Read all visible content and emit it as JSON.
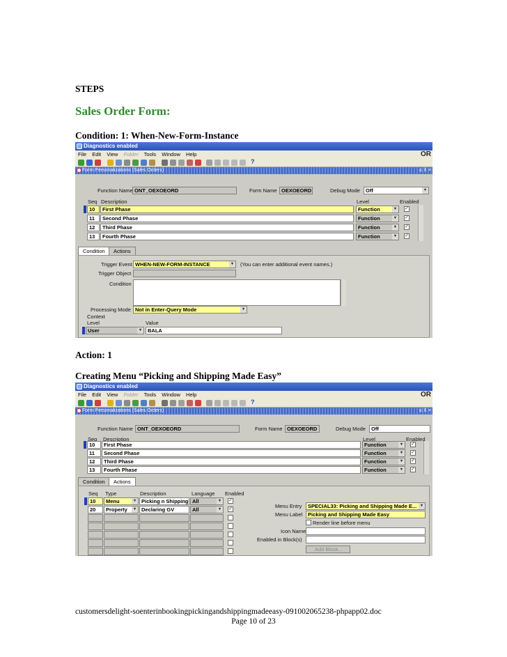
{
  "headings": {
    "steps": "STEPS",
    "sales_order_form": "Sales Order Form:",
    "condition": "Condition: 1: When-New-Form-Instance",
    "action": "Action: 1",
    "creating_menu": "Creating Menu “Picking and Shipping Made Easy”"
  },
  "app": {
    "titlebar": "Diagnostics enabled",
    "menu": [
      "File",
      "Edit",
      "View",
      "Folder",
      "Tools",
      "Window",
      "Help"
    ],
    "logo": "OR",
    "form_window_title": "Form Personalizations (Sales Orders)"
  },
  "form": {
    "function_name_label": "Function Name",
    "function_name": "ONT_OEXOEORD",
    "form_name_label": "Form Name",
    "form_name": "OEXOEORD",
    "debug_mode_label": "Debug Mode",
    "debug_mode": "Off",
    "col_seq": "Seq",
    "col_description": "Description",
    "col_level": "Level",
    "col_enabled": "Enabled",
    "rows": [
      {
        "seq": "10",
        "description": "First Phase",
        "level": "Function"
      },
      {
        "seq": "11",
        "description": "Second Phase",
        "level": "Function"
      },
      {
        "seq": "12",
        "description": "Third Phase",
        "level": "Function"
      },
      {
        "seq": "13",
        "description": "Fourth Phase",
        "level": "Function"
      }
    ]
  },
  "condition_tab": {
    "tab_condition": "Condition",
    "tab_actions": "Actions",
    "trigger_event_label": "Trigger Event",
    "trigger_event": "WHEN-NEW-FORM-INSTANCE",
    "trigger_hint": "(You can enter additional event names.)",
    "trigger_object_label": "Trigger Object",
    "condition_label": "Condition",
    "processing_mode_label": "Processing Mode",
    "processing_mode": "Not in Enter-Query Mode",
    "context_label": "Context",
    "level_label": "Level",
    "value_label": "Value",
    "level": "User",
    "value": "BALA"
  },
  "actions_tab": {
    "col_seq": "Seq",
    "col_type": "Type",
    "col_description": "Description",
    "col_language": "Language",
    "col_enabled": "Enabled",
    "rows": [
      {
        "seq": "10",
        "type": "Menu",
        "description": "Picking n Shipping M",
        "language": "All"
      },
      {
        "seq": "20",
        "type": "Property",
        "description": "Declaring GV",
        "language": "All"
      }
    ],
    "menu_entry_label": "Menu Entry",
    "menu_entry": "SPECIAL33: Picking and Shipping Made E...",
    "menu_label_label": "Menu Label",
    "menu_label": "Picking and Shipping Made Easy",
    "render_line_label": "Render line before menu",
    "icon_name_label": "Icon Name",
    "enabled_in_blocks_label": "Enabled in Block(s)",
    "add_block_button": "Add Block..."
  },
  "footer": {
    "filename": "customersdelight-soenterinbookingpickingandshippingmadeeasy-091002065238-phpapp02.doc",
    "page": "Page 10 of 23"
  }
}
